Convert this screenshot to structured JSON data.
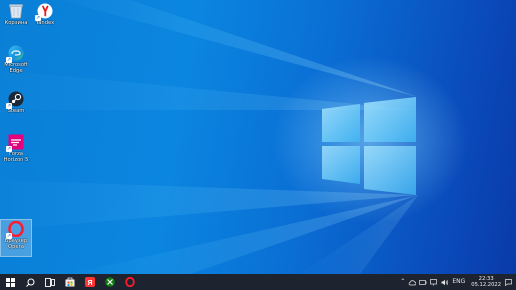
{
  "desktop": {
    "icons": [
      {
        "label": "Корзина",
        "icon": "recycle-bin-icon"
      },
      {
        "label": "Yandex",
        "icon": "yandex-browser-icon"
      },
      {
        "label": "Microsoft Edge",
        "icon": "edge-icon"
      },
      {
        "label": "Steam",
        "icon": "steam-icon"
      },
      {
        "label": "Forza Horizon 5",
        "icon": "forza-horizon-icon"
      },
      {
        "label": "Браузер Opera",
        "icon": "opera-icon"
      }
    ]
  },
  "taskbar": {
    "items": [
      "start-icon",
      "search-icon",
      "task-view-icon",
      "store-icon",
      "yandex-browser-icon",
      "xbox-icon",
      "opera-icon"
    ],
    "tray": {
      "language": "ENG",
      "time": "22:33",
      "date": "05.12.2022"
    }
  },
  "colors": {
    "taskbar": "#1d2430",
    "wallpaper_accent": "#0a7fd6"
  }
}
